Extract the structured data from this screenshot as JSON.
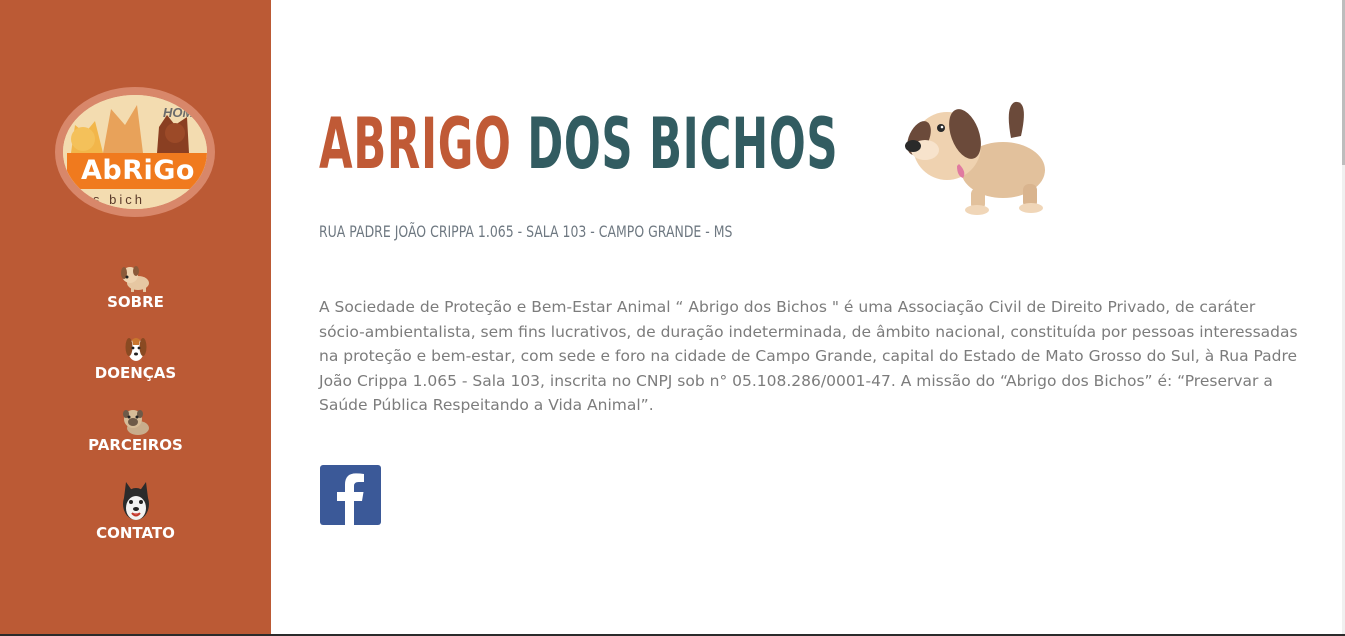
{
  "logo": {
    "home_text": "HOM",
    "word": "AbRiGo",
    "sub": "s bich"
  },
  "nav": [
    {
      "label": "SOBRE",
      "icon": "puppy-icon"
    },
    {
      "label": "DOENÇAS",
      "icon": "beagle-icon"
    },
    {
      "label": "PARCEIROS",
      "icon": "pug-icon"
    },
    {
      "label": "CONTATO",
      "icon": "husky-icon"
    }
  ],
  "header": {
    "title_part1": "ABRIGO",
    "title_part2": "DOS BICHOS",
    "address": "RUA PADRE JOÃO CRIPPA 1.065 - SALA 103 - CAMPO GRANDE - MS"
  },
  "main": {
    "description": "A Sociedade de Proteção e Bem-Estar Animal “ Abrigo dos Bichos \" é uma Associação Civil de Direito Privado, de caráter sócio-ambientalista, sem fins lucrativos, de duração indeterminada, de âmbito nacional, constituída por pessoas interessadas na proteção e bem-estar, com sede e foro na cidade de Campo Grande, capital do Estado de Mato Grosso do Sul, à Rua Padre João Crippa 1.065 - Sala 103, inscrita no CNPJ sob n° 05.108.286/0001-47. A missão do “Abrigo dos Bichos” é: “Preservar a Saúde Pública Respeitando a Vida Animal”."
  },
  "social": {
    "facebook_icon": "facebook-icon"
  },
  "colors": {
    "sidebar": "#bb5a35",
    "title_orange": "#c05a36",
    "title_teal": "#325c61",
    "facebook": "#3b5998"
  }
}
